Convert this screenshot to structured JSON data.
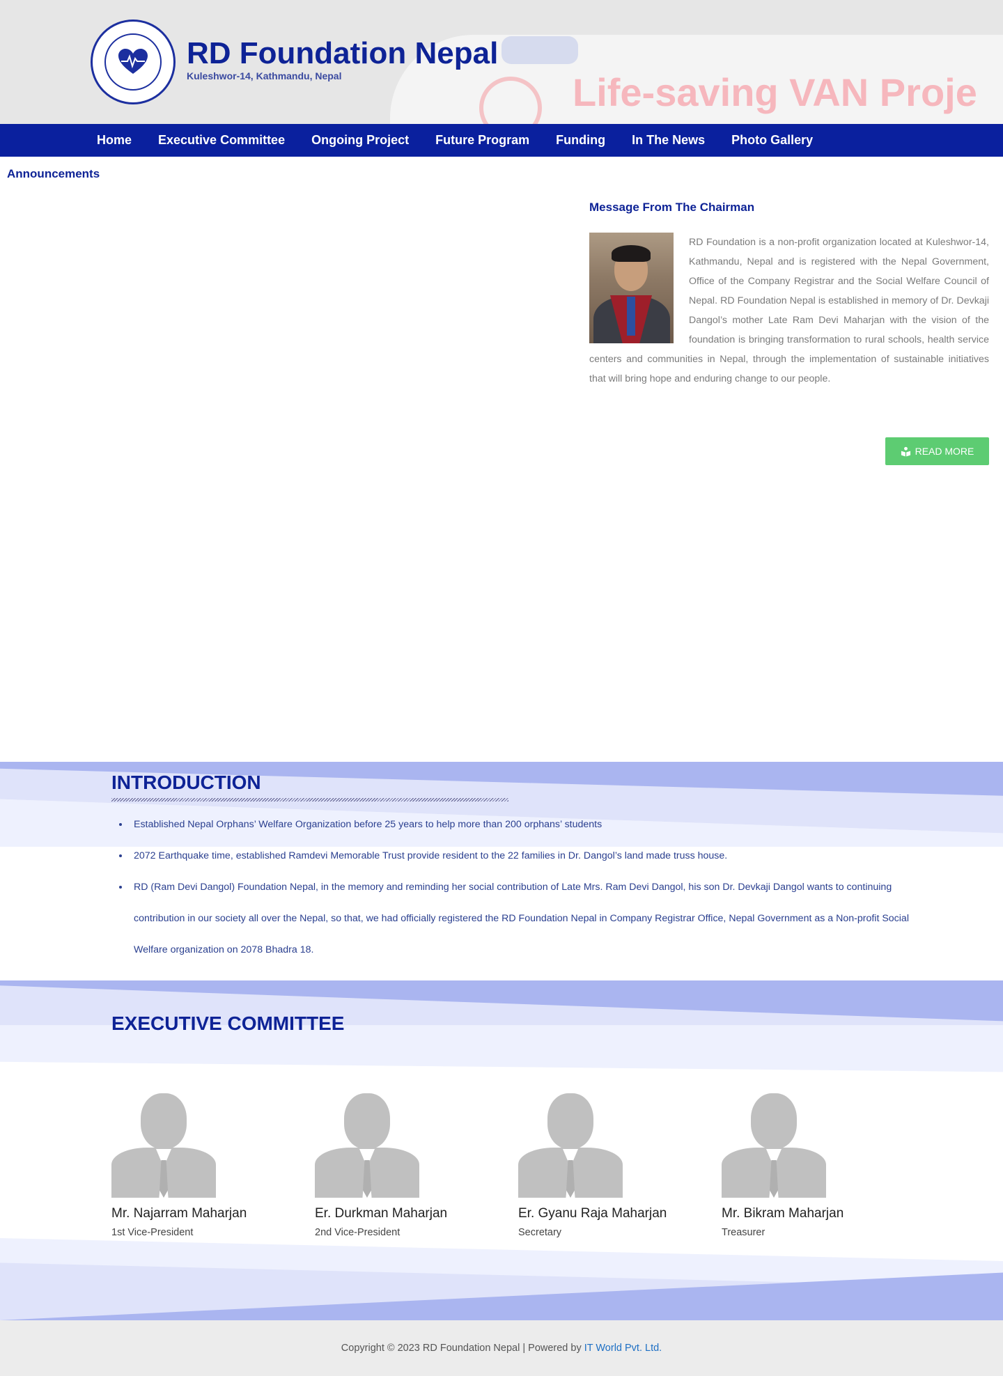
{
  "header": {
    "title": "RD Foundation Nepal",
    "subtitle": "Kuleshwor-14, Kathmandu, Nepal",
    "banner_text": "Life-saving VAN Proje"
  },
  "nav": {
    "items": [
      {
        "label": "Home"
      },
      {
        "label": "Executive Committee"
      },
      {
        "label": "Ongoing Project"
      },
      {
        "label": "Future Program"
      },
      {
        "label": "Funding"
      },
      {
        "label": "In The News"
      },
      {
        "label": "Photo Gallery"
      }
    ]
  },
  "announcements": {
    "title": "Announcements"
  },
  "chairman": {
    "title": "Message From The Chairman",
    "message": "RD Foundation is a non-profit organization located at Kuleshwor-14, Kathmandu, Nepal and is registered with the Nepal Government, Office of the Company Registrar and the Social Welfare Council of Nepal. RD Foundation Nepal is established in memory of Dr. Devkaji Dangol’s mother Late Ram Devi Maharjan with the vision of the foundation is bringing transformation to rural schools, health service centers and communities in Nepal, through the implementation of sustainable initiatives that will bring hope and enduring change to our people.",
    "read_more": "READ MORE"
  },
  "introduction": {
    "title": "INTRODUCTION",
    "items": [
      "Established Nepal Orphans’ Welfare Organization before 25 years to help more than 200 orphans’ students",
      "2072 Earthquake time, established Ramdevi Memorable Trust provide resident  to the 22 families in Dr. Dangol’s land made truss house.",
      "RD (Ram Devi Dangol) Foundation Nepal, in the memory and reminding her social contribution of Late Mrs. Ram Devi Dangol, his son Dr. Devkaji Dangol wants to continuing contribution in our society all over the Nepal, so that, we had officially registered the RD Foundation Nepal in Company Registrar Office, Nepal Government as a Non-profit Social Welfare organization on 2078 Bhadra 18."
    ]
  },
  "executive": {
    "title": "EXECUTIVE COMMITTEE",
    "members": [
      {
        "name": "Mr. Najarram Maharjan",
        "role": "1st Vice-President"
      },
      {
        "name": "Er. Durkman Maharjan",
        "role": "2nd Vice-President"
      },
      {
        "name": "Er. Gyanu Raja Maharjan",
        "role": "Secretary"
      },
      {
        "name": "Mr. Bikram Maharjan",
        "role": "Treasurer"
      }
    ]
  },
  "footer": {
    "copyright": "Copyright © 2023 RD Foundation Nepal | Powered by",
    "powered_by": "IT World Pvt. Ltd."
  },
  "colors": {
    "brand": "#0a209e",
    "accent_green": "#5dcc72",
    "band_light": "#dfe3fa",
    "band_mid": "#aab5f0"
  }
}
